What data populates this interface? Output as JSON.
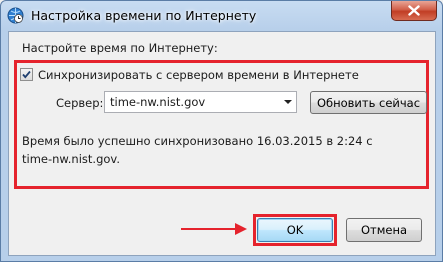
{
  "window": {
    "title": "Настройка времени по Интернету"
  },
  "content": {
    "instruction": "Настройте время по Интернету:",
    "sync_checkbox": {
      "label": "Синхронизировать с сервером времени в Интернете",
      "checked": true
    },
    "server": {
      "label": "Сервер:",
      "value": "time-nw.nist.gov"
    },
    "update_button": "Обновить сейчас",
    "status_line1": "Время было успешно синхронизовано 16.03.2015 в 2:24 с",
    "status_line2": "time-nw.nist.gov."
  },
  "buttons": {
    "ok": "OK",
    "cancel": "Отмена"
  },
  "annotations": {
    "highlight_color": "#e5232d"
  },
  "icons": {
    "title": "clock-globe-icon",
    "close": "close-icon",
    "dropdown": "chevron-down-icon",
    "check": "checkmark-icon",
    "pointer": "red-arrow-icon"
  }
}
